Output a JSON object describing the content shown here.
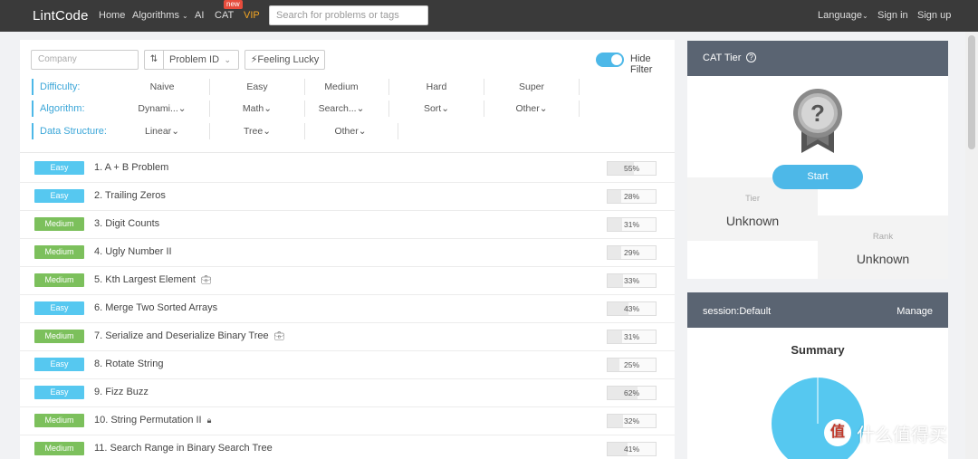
{
  "nav": {
    "logo": "LintCode",
    "items": [
      "Home",
      "Algorithms",
      "AI",
      "CAT",
      "VIP"
    ],
    "new_badge": "new",
    "search_placeholder": "Search for problems or tags",
    "language": "Language",
    "sign_in": "Sign in",
    "sign_up": "Sign up"
  },
  "filters": {
    "company_placeholder": "Company",
    "sort_icon": "sort-icon",
    "problem_id_select": "Problem ID",
    "feeling_lucky": "Feeling Lucky",
    "hide_filter": "Hide Filter",
    "hide_filter_on": true,
    "rows": [
      {
        "label": "Difficulty:",
        "options": [
          "Naive",
          "Easy",
          "Medium",
          "Hard",
          "Super"
        ]
      },
      {
        "label": "Algorithm:",
        "options": [
          "Dynami...",
          "Math",
          "Search...",
          "Sort",
          "Other"
        ]
      },
      {
        "label": "Data Structure:",
        "options": [
          "Linear",
          "Tree",
          "Other"
        ]
      }
    ]
  },
  "problems": [
    {
      "difficulty": "Easy",
      "title": "1. A + B Problem",
      "rate": "55%",
      "icon": ""
    },
    {
      "difficulty": "Easy",
      "title": "2. Trailing Zeros",
      "rate": "28%",
      "icon": ""
    },
    {
      "difficulty": "Medium",
      "title": "3. Digit Counts",
      "rate": "31%",
      "icon": ""
    },
    {
      "difficulty": "Medium",
      "title": "4. Ugly Number II",
      "rate": "29%",
      "icon": ""
    },
    {
      "difficulty": "Medium",
      "title": "5. Kth Largest Element",
      "rate": "33%",
      "icon": "briefcase-icon"
    },
    {
      "difficulty": "Easy",
      "title": "6. Merge Two Sorted Arrays",
      "rate": "43%",
      "icon": ""
    },
    {
      "difficulty": "Medium",
      "title": "7. Serialize and Deserialize Binary Tree",
      "rate": "31%",
      "icon": "briefcase-icon"
    },
    {
      "difficulty": "Easy",
      "title": "8. Rotate String",
      "rate": "25%",
      "icon": ""
    },
    {
      "difficulty": "Easy",
      "title": "9. Fizz Buzz",
      "rate": "62%",
      "icon": ""
    },
    {
      "difficulty": "Medium",
      "title": "10. String Permutation II",
      "rate": "32%",
      "icon": "lock-icon"
    },
    {
      "difficulty": "Medium",
      "title": "11. Search Range in Binary Search Tree",
      "rate": "41%",
      "icon": ""
    }
  ],
  "cat_card": {
    "title": "CAT Tier",
    "help_icon": "question-circle-icon",
    "medal_icon": "question-medal-icon",
    "start": "Start",
    "tier_label": "Tier",
    "tier_value": "Unknown",
    "rank_label": "Rank",
    "rank_value": "Unknown"
  },
  "session_card": {
    "title": "session:Default",
    "manage": "Manage",
    "summary": "Summary"
  },
  "colors": {
    "easy": "#56c8f0",
    "medium": "#7cc05c",
    "accent": "#4db8e8",
    "nav_bg": "#3a3a3a",
    "vip": "#f5a623",
    "card_header": "#5a6472"
  },
  "watermark": {
    "logo": "值",
    "text": "什么值得买"
  }
}
